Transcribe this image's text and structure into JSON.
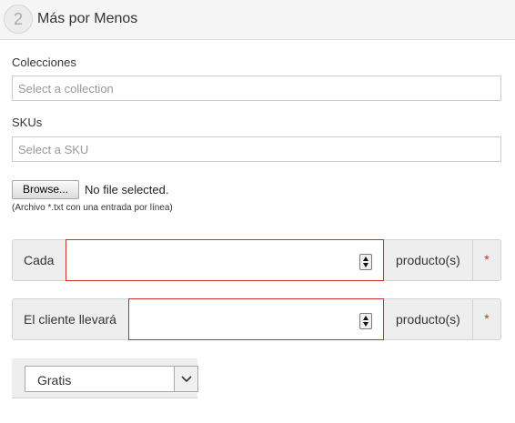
{
  "header": {
    "step_number": "2",
    "title": "Más por Menos"
  },
  "collections": {
    "label": "Colecciones",
    "placeholder": "Select a collection"
  },
  "skus": {
    "label": "SKUs",
    "placeholder": "Select a SKU"
  },
  "file_upload": {
    "button_label": "Browse...",
    "status": "No file selected.",
    "hint": "(Archivo *.txt con una entrada por línea)"
  },
  "every_group": {
    "label": "Cada",
    "value": "",
    "suffix": "producto(s)",
    "required_mark": "*"
  },
  "customer_group": {
    "label": "El cliente llevará",
    "value": "",
    "suffix": "producto(s)",
    "required_mark": "*"
  },
  "discount_type": {
    "selected": "Gratis"
  },
  "colors": {
    "required_border": "#c9302c",
    "accent_red": "#c9302c"
  }
}
